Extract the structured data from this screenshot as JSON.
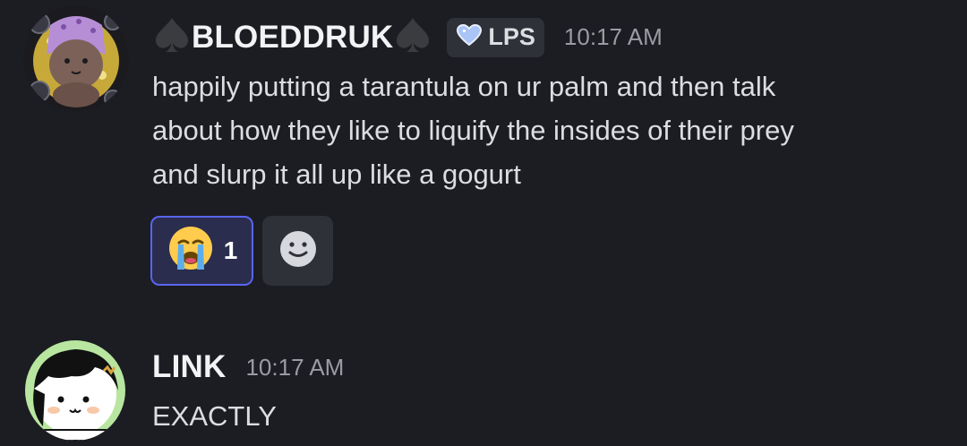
{
  "messages": [
    {
      "username": "BLOEDDRUK",
      "tag": {
        "label": "LPS",
        "icon": "heart-icon"
      },
      "timestamp": "10:17 AM",
      "lines": [
        "happily putting a tarantula on ur palm and then talk",
        "about how they like to liquify the insides of their prey",
        "and slurp it all up like a gogurt"
      ],
      "reactions": [
        {
          "emoji": "😭",
          "count": "1",
          "active": true
        }
      ],
      "add_reaction_icon": "add-reaction-icon"
    },
    {
      "username": "LINK",
      "timestamp": "10:17 AM",
      "lines": [
        "EXACTLY"
      ]
    }
  ],
  "colors": {
    "background": "#1c1d22",
    "active_reaction_border": "#5865f2",
    "timestamp": "#9a9ca3"
  }
}
